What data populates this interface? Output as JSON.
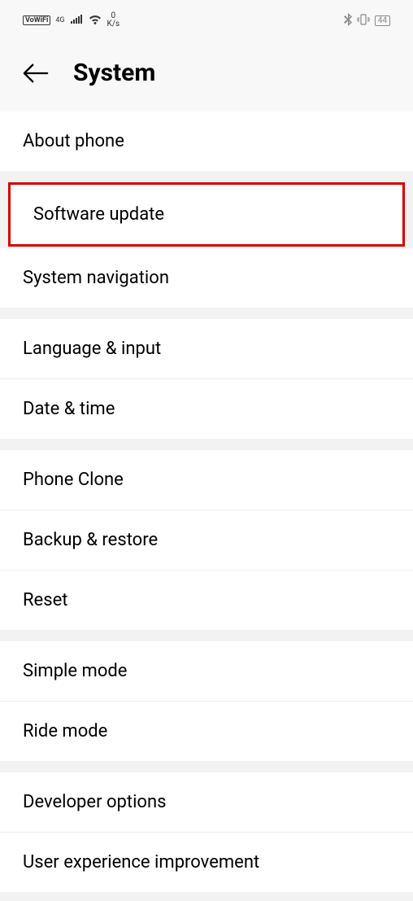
{
  "status": {
    "vowifi": "VoWiFi",
    "net_type": "4G",
    "speed_top": "0",
    "speed_bottom": "K/s",
    "battery": "44"
  },
  "header": {
    "title": "System"
  },
  "sections": [
    {
      "items": [
        {
          "label": "About phone"
        }
      ]
    },
    {
      "highlight": true,
      "items": [
        {
          "label": "Software update"
        }
      ]
    },
    {
      "items": [
        {
          "label": "System navigation"
        }
      ]
    },
    {
      "items": [
        {
          "label": "Language & input"
        },
        {
          "label": "Date & time"
        }
      ]
    },
    {
      "items": [
        {
          "label": "Phone Clone"
        },
        {
          "label": "Backup & restore"
        },
        {
          "label": "Reset"
        }
      ]
    },
    {
      "items": [
        {
          "label": "Simple mode"
        },
        {
          "label": "Ride mode"
        }
      ]
    },
    {
      "items": [
        {
          "label": "Developer options"
        },
        {
          "label": "User experience improvement"
        }
      ]
    }
  ]
}
